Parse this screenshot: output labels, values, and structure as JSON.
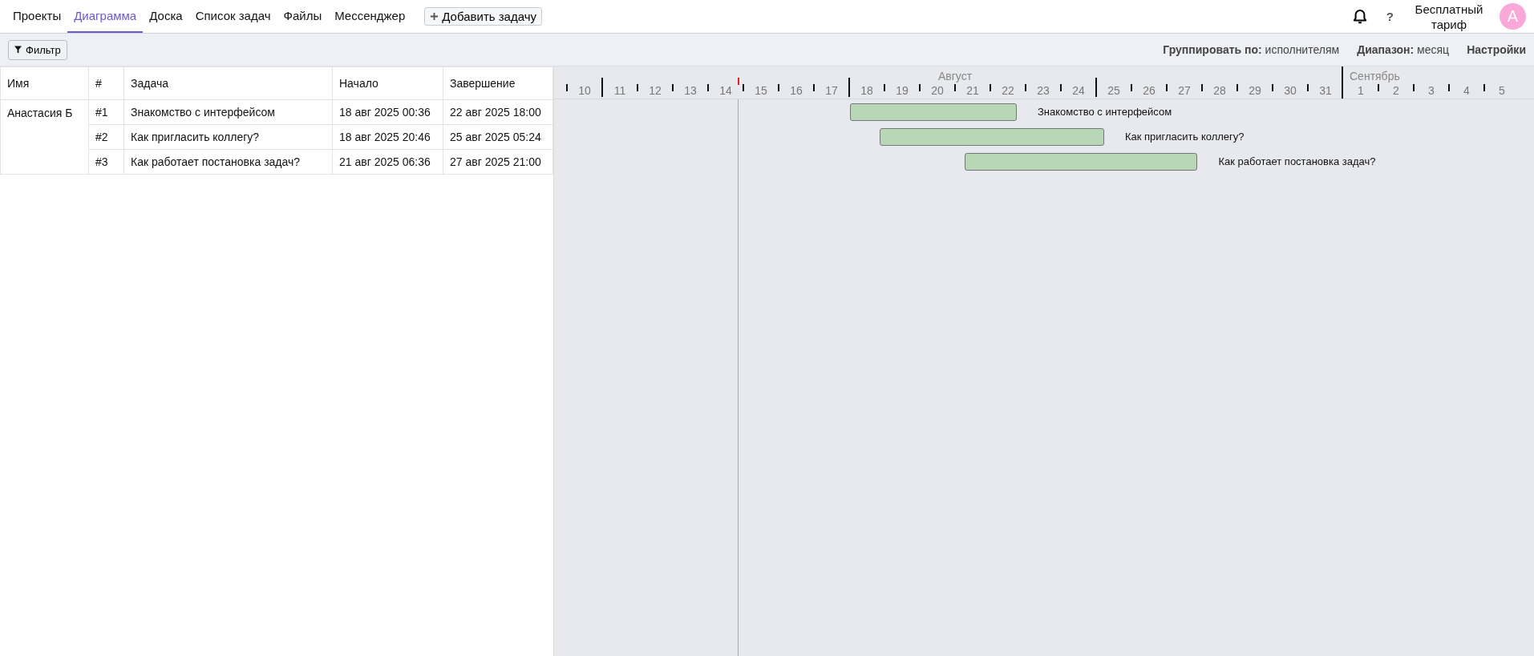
{
  "nav": {
    "tabs": [
      {
        "label": "Проекты",
        "selected": false
      },
      {
        "label": "Диаграмма",
        "selected": true
      },
      {
        "label": "Доска",
        "selected": false
      },
      {
        "label": "Список задач",
        "selected": false
      },
      {
        "label": "Файлы",
        "selected": false
      },
      {
        "label": "Мессенджер",
        "selected": false
      }
    ],
    "add_button": "Добавить задачу",
    "help": "?",
    "plan": "Бесплатный тариф",
    "avatar": "A"
  },
  "toolbar": {
    "filter": "Фильтр",
    "group_label": "Группировать по:",
    "group_value": "исполнителям",
    "range_label": "Диапазон:",
    "range_value": "месяц",
    "settings": "Настройки"
  },
  "table": {
    "columns": [
      "Имя",
      "#",
      "Задача",
      "Начало",
      "Завершение"
    ],
    "groups": [
      {
        "name": "Анастасия Б",
        "rows": [
          {
            "num": "#1",
            "task": "Знакомство с интерфейсом",
            "start": "18 авг 2025 00:36",
            "end": "22 авг 2025 18:00"
          },
          {
            "num": "#2",
            "task": "Как пригласить коллегу?",
            "start": "18 авг 2025 20:46",
            "end": "25 авг 2025 05:24"
          },
          {
            "num": "#3",
            "task": "Как работает постановка задач?",
            "start": "21 авг 2025 06:36",
            "end": "27 авг 2025 21:00"
          }
        ]
      }
    ]
  },
  "timeline": {
    "months": [
      {
        "label": "Август",
        "days": [
          "10",
          "11",
          "12",
          "13",
          "14",
          "15",
          "16",
          "17",
          "18",
          "19",
          "20",
          "21",
          "22",
          "23",
          "24",
          "25",
          "26",
          "27",
          "28",
          "29",
          "30",
          "31"
        ]
      },
      {
        "label": "Сентябрь",
        "days": [
          "1",
          "2",
          "3",
          "4",
          "5"
        ]
      }
    ],
    "bars": [
      {
        "label": "Знакомство с интерфейсом"
      },
      {
        "label": "Как пригласить коллегу?"
      },
      {
        "label": "Как работает постановка задач?"
      }
    ]
  }
}
